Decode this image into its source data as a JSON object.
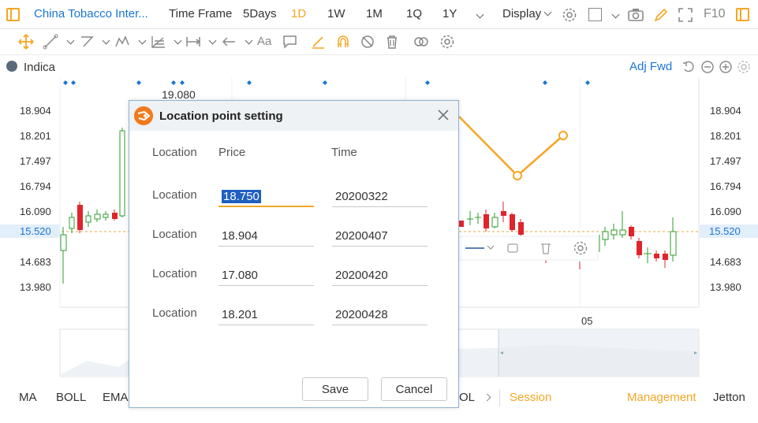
{
  "topbar": {
    "symbol": "China Tobacco Inter...",
    "time_frame_label": "Time Frame",
    "frames": [
      "5Days",
      "1D",
      "1W",
      "1M",
      "1Q",
      "1Y"
    ],
    "active_frame": "1D",
    "display_label": "Display",
    "f10_label": "F10",
    "accent": "#f5a623",
    "link_color": "#1976d2"
  },
  "indicator_row": {
    "label": "Indica",
    "adj_label": "Adj Fwd"
  },
  "chart": {
    "top_label": "19.080",
    "date_label": "05",
    "left_ticks": [
      "18.904",
      "18.201",
      "17.497",
      "16.794",
      "16.090",
      "15.520",
      "14.683",
      "13.980"
    ],
    "right_ticks": [
      "18.904",
      "18.201",
      "17.497",
      "16.794",
      "16.090",
      "15.520",
      "14.683",
      "13.980"
    ],
    "current_price": "15.520",
    "up_color": "#2e9e2e",
    "down_color": "#e0242c",
    "line_color": "#f5a623"
  },
  "bottombar": {
    "tabs": [
      "MA",
      "BOLL",
      "EMA",
      "OL"
    ],
    "session_label": "Session",
    "management_label": "Management",
    "jetton_label": "Jetton"
  },
  "dialog": {
    "title": "Location point setting",
    "col_location": "Location",
    "col_price": "Price",
    "col_time": "Time",
    "rows": [
      {
        "label": "Location",
        "price": "18.750",
        "time": "20200322"
      },
      {
        "label": "Location",
        "price": "18.904",
        "time": "20200407"
      },
      {
        "label": "Location",
        "price": "17.080",
        "time": "20200420"
      },
      {
        "label": "Location",
        "price": "18.201",
        "time": "20200428"
      }
    ],
    "save_label": "Save",
    "cancel_label": "Cancel"
  }
}
